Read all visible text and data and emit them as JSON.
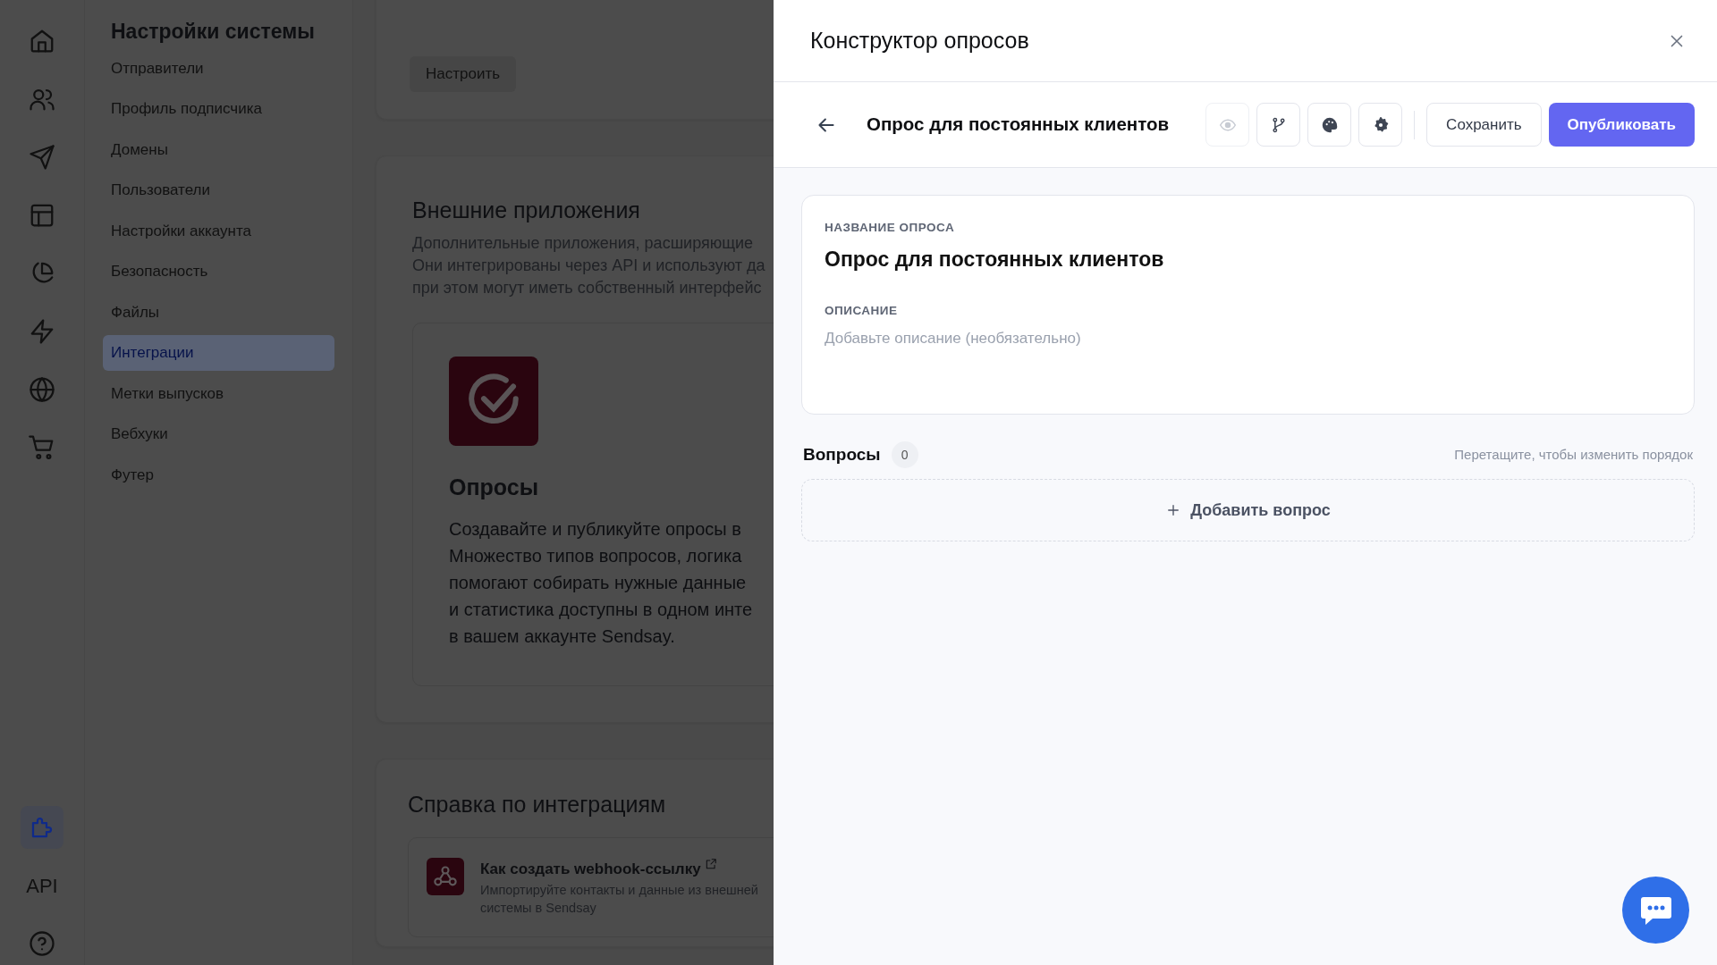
{
  "rail": {
    "items": [
      {
        "kind": "icon",
        "selected": false
      },
      {
        "kind": "icon",
        "selected": false
      },
      {
        "kind": "icon",
        "selected": false
      },
      {
        "kind": "icon",
        "selected": false
      },
      {
        "kind": "icon",
        "selected": false
      },
      {
        "kind": "icon",
        "selected": false
      },
      {
        "kind": "icon",
        "selected": false
      },
      {
        "kind": "icon",
        "selected": false
      },
      {
        "kind": "icon",
        "selected": true
      },
      {
        "kind": "text",
        "label": "API",
        "selected": false
      },
      {
        "kind": "icon",
        "selected": false
      }
    ]
  },
  "sidebar": {
    "title": "Настройки системы",
    "items": [
      {
        "label": "Отправители",
        "selected": false
      },
      {
        "label": "Профиль подписчика",
        "selected": false
      },
      {
        "label": "Домены",
        "selected": false
      },
      {
        "label": "Пользователи",
        "selected": false
      },
      {
        "label": "Настройки аккаунта",
        "selected": false
      },
      {
        "label": "Безопасность",
        "selected": false
      },
      {
        "label": "Файлы",
        "selected": false
      },
      {
        "label": "Интеграции",
        "selected": true
      },
      {
        "label": "Метки выпусков",
        "selected": false
      },
      {
        "label": "Вебхуки",
        "selected": false
      },
      {
        "label": "Футер",
        "selected": false
      }
    ]
  },
  "main": {
    "setup_button": "Настроить",
    "external_apps": {
      "title": "Внешние приложения",
      "description_lines": [
        "Дополнительные приложения, расширяющие",
        "Они интегрированы через API и используют да",
        "при этом могут иметь собственный интерфейс"
      ],
      "app": {
        "title": "Опросы",
        "description_lines": [
          "Создавайте и публикуйте опросы в",
          "Множество типов вопросов, логика",
          "помогают собирать нужные данные",
          "и статистика доступны в одном инте",
          "в вашем аккаунте Sendsay."
        ]
      }
    },
    "help": {
      "title": "Справка по интеграциям",
      "articles": [
        {
          "title": "Как создать webhook-ссылку",
          "description_lines": [
            "Импортируйте контакты и данные из внешней",
            "системы в Sendsay"
          ]
        }
      ]
    }
  },
  "drawer": {
    "title": "Конструктор опросов",
    "toolbar": {
      "survey_title": "Опрос для постоянных клиентов",
      "icon_buttons": [
        {
          "disabled": true
        },
        {
          "disabled": false
        },
        {
          "disabled": false
        },
        {
          "disabled": false
        }
      ],
      "save": "Сохранить",
      "publish": "Опубликовать"
    },
    "form": {
      "name_label": "НАЗВАНИЕ ОПРОСА",
      "name_value": "Опрос для постоянных клиентов",
      "description_label": "ОПИСАНИЕ",
      "description_placeholder": "Добавьте описание (необязательно)"
    },
    "questions": {
      "title": "Вопросы",
      "count": "0",
      "hint": "Перетащите, чтобы изменить порядок",
      "add_button": "Добавить вопрос"
    }
  }
}
